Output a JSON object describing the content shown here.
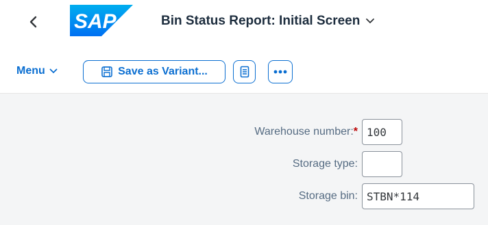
{
  "header": {
    "back_icon": "chevron-left-icon",
    "logo_text": "SAP",
    "title": "Bin Status Report: Initial Screen"
  },
  "toolbar": {
    "menu_label": "Menu",
    "save_variant_label": "Save as Variant...",
    "overflow_icon": "more-icon"
  },
  "form": {
    "warehouse": {
      "label": "Warehouse number:",
      "required_marker": "*",
      "value": "100"
    },
    "storage_type": {
      "label": "Storage type:",
      "value": ""
    },
    "storage_bin": {
      "label": "Storage bin:",
      "value": "STBN*114"
    }
  },
  "colors": {
    "accent": "#0a6ed1",
    "sap_logo_blue": "#0070f2",
    "required": "#bb0000",
    "content_bg": "#f4f5f6"
  }
}
